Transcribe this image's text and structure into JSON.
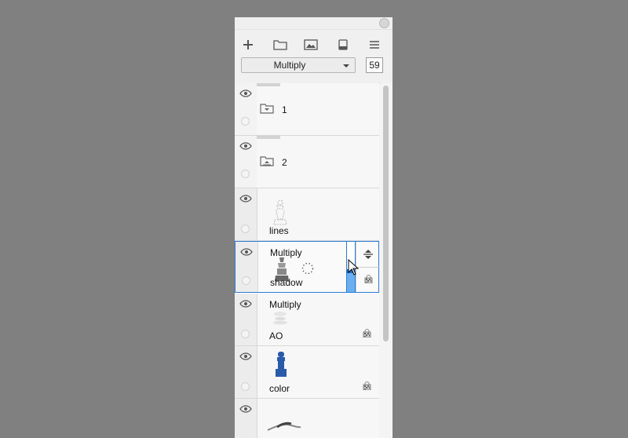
{
  "toolbar": {
    "icons": [
      "plus-icon",
      "folder-icon",
      "image-icon",
      "reference-icon",
      "menu-icon"
    ],
    "blend_mode": "Multiply",
    "opacity": "59"
  },
  "folders": [
    {
      "name": "1",
      "icon": "folder-collapse-icon"
    },
    {
      "name": "2",
      "icon": "folder-expand-icon"
    }
  ],
  "layers": [
    {
      "name": "lines",
      "blend": "",
      "locked": false
    },
    {
      "name": "shadow",
      "blend": "Multiply",
      "locked": true,
      "selected": true
    },
    {
      "name": "AO",
      "blend": "Multiply",
      "locked": true
    },
    {
      "name": "color",
      "blend": "",
      "locked": true
    },
    {
      "name": "",
      "blend": "",
      "locked": false
    }
  ],
  "colors": {
    "accent": "#2a7bd4",
    "slider_fill": "#6ab0f0",
    "color_layer": "#2a5aaa"
  },
  "opacity_level": 0.59
}
